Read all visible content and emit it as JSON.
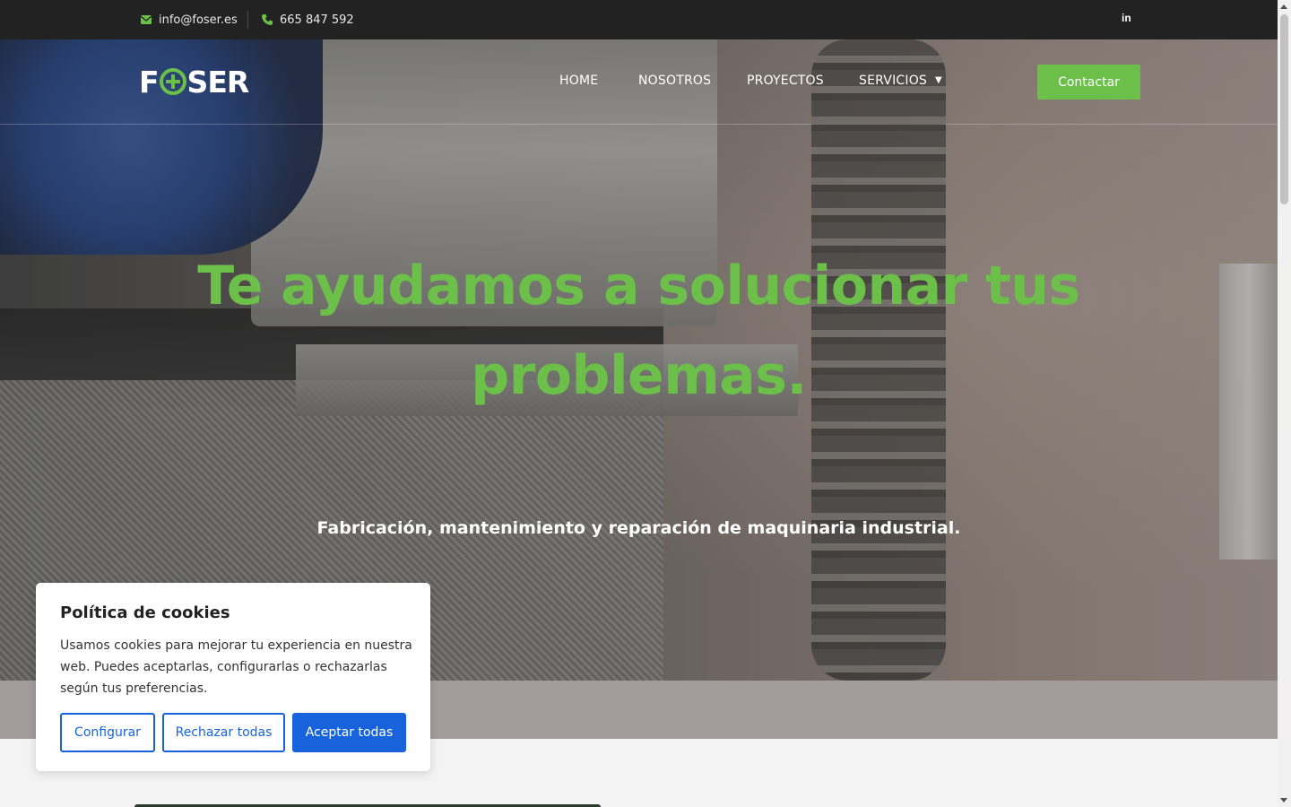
{
  "topbar": {
    "email": "info@foser.es",
    "phone": "665 847 592",
    "email_icon": "envelope-icon",
    "phone_icon": "phone-icon",
    "social_label": "in",
    "social_icon": "linkedin-icon"
  },
  "brand": {
    "logo_text_left": "F",
    "logo_text_right": "SER",
    "accent_color": "#6cc04a"
  },
  "nav": {
    "items": [
      {
        "label": "HOME"
      },
      {
        "label": "NOSOTROS"
      },
      {
        "label": "PROYECTOS"
      },
      {
        "label": "SERVICIOS"
      }
    ],
    "cta": "Contactar"
  },
  "hero": {
    "title_line1": "Te ayudamos a solucionar tus",
    "title_line2": "problemas.",
    "subtitle": "Fabricación, mantenimiento y reparación de maquinaria industrial."
  },
  "cookie": {
    "title": "Política de cookies",
    "body": "Usamos cookies para mejorar tu experiencia en nuestra web. Puedes aceptarlas, configurarlas o rechazarlas según tus preferencias.",
    "configure": "Configurar",
    "reject": "Rechazar todas",
    "accept": "Aceptar todas",
    "button_color": "#1863dc"
  }
}
